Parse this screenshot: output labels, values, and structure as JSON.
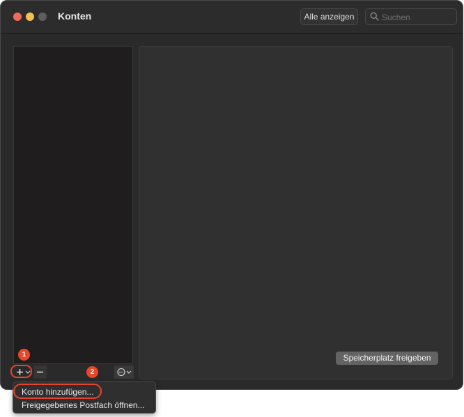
{
  "window": {
    "title": "Konten"
  },
  "toolbar": {
    "show_all_label": "Alle anzeigen",
    "search_placeholder": "Suchen"
  },
  "detail": {
    "free_storage_label": "Speicherplatz freigeben"
  },
  "menu": {
    "items": [
      {
        "label": "Konto hinzufügen..."
      },
      {
        "label": "Freigegebenes Postfach öffnen..."
      }
    ]
  },
  "annotations": {
    "step1": "1",
    "step2": "2",
    "color": "#e8442a"
  }
}
